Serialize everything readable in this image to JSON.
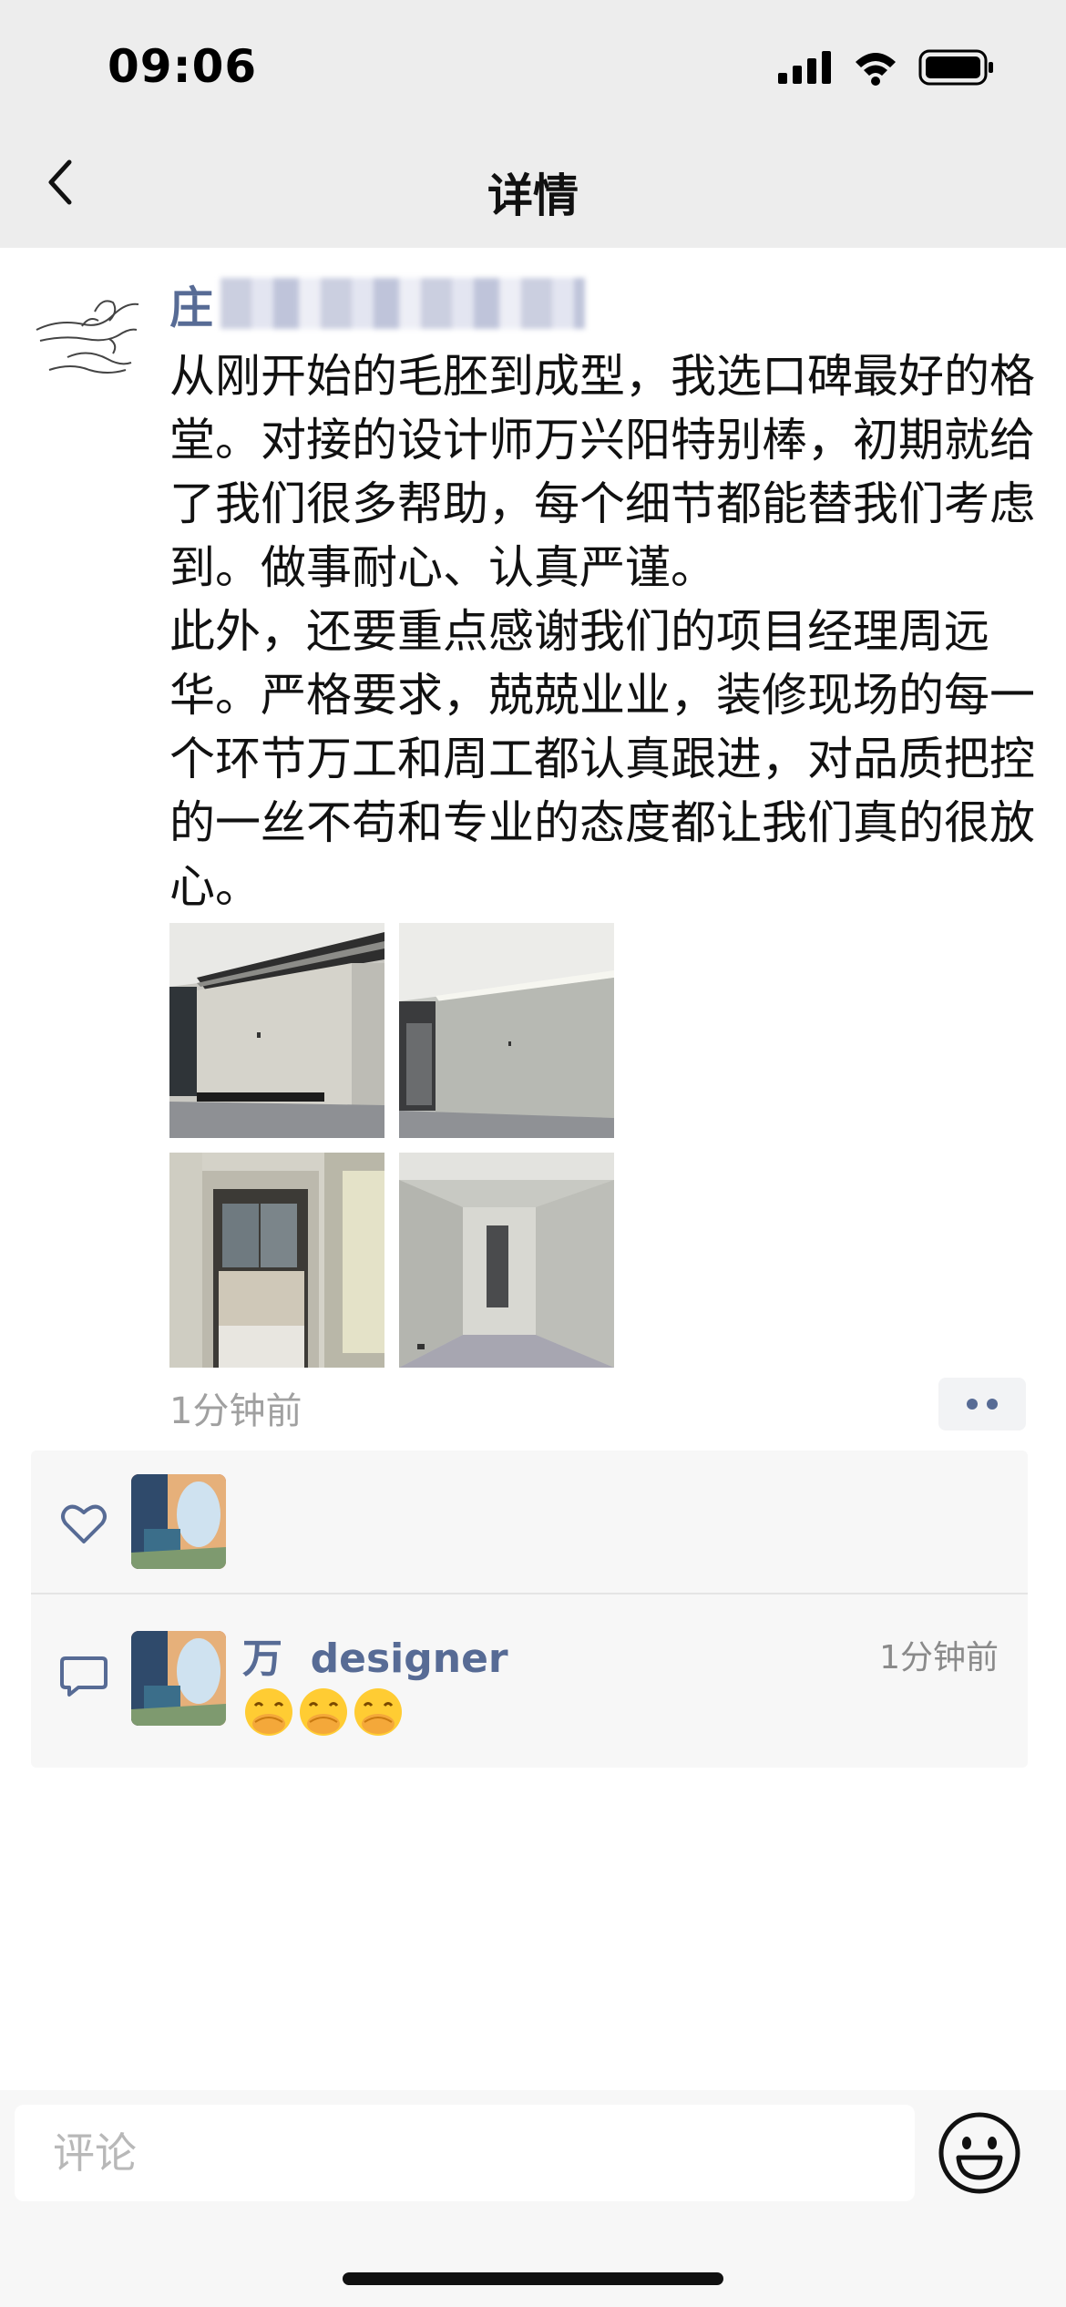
{
  "status_bar": {
    "time": "09:06",
    "icons": [
      "cellular-signal-icon",
      "wifi-icon",
      "battery-icon"
    ]
  },
  "nav": {
    "back_icon": "chevron-left-icon",
    "title": "详情"
  },
  "post": {
    "author_name": "庄",
    "text": "从刚开始的毛胚到成型，我选口碑最好的格堂。对接的设计师万兴阳特别棒，初期就给了我们很多帮助，每个细节都能替我们考虑到。做事耐心、认真严谨。\n此外，还要重点感谢我们的项目经理周远华。严格要求，兢兢业业，装修现场的每一个环节万工和周工都认真跟进，对品质把控的一丝不苟和专业的态度都让我们真的很放心。",
    "photos": [
      "living-room-photo",
      "hallway-room-photo",
      "bathroom-doorway-photo",
      "corridor-photo"
    ],
    "time": "1分钟前",
    "more_icon": "more-dots-icon"
  },
  "likes": {
    "icon": "heart-icon",
    "count_avatars": 1
  },
  "comments": [
    {
      "author": "万  designer",
      "time": "1分钟前",
      "emojis": [
        "🤭",
        "🤭",
        "🤭"
      ]
    }
  ],
  "composer": {
    "placeholder": "评论",
    "emoji_icon": "smiley-face-icon"
  },
  "colors": {
    "link_blue": "#576b95",
    "top_bar_bg": "#ededed",
    "panel_bg": "#f7f7f7",
    "secondary_text": "#a0a0a0"
  }
}
